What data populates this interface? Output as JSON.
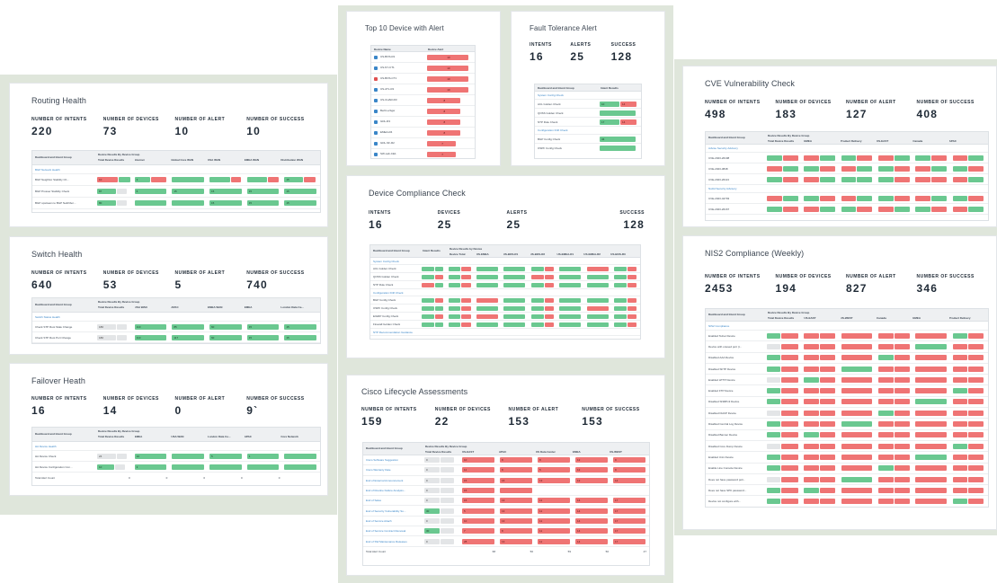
{
  "routing": {
    "title": "Routing Health",
    "stats": [
      {
        "label": "NUMBER OF INTENTS",
        "value": "220"
      },
      {
        "label": "NUMBER OF DEVICES",
        "value": "73"
      },
      {
        "label": "NUMBER OF ALERT",
        "value": "10"
      },
      {
        "label": "NUMBER OF SUCCESS",
        "value": "10"
      }
    ],
    "col_group": "Dashboard and Intent Group",
    "col_devices": "Device Results By Device Group",
    "cols": [
      "Total Device Results",
      "Internet",
      "Global Core WAN",
      "USA WAN",
      "EMEA WAN",
      "Distribution WAN"
    ],
    "group": "BGP Network Health",
    "rows": [
      {
        "name": "BGP Neighbor Stability Ch...",
        "cells": [
          [
            "r",
            "10"
          ],
          [
            "g",
            "3"
          ],
          [
            "gr",
            ""
          ],
          [
            "gr",
            ""
          ],
          [
            "gr",
            ""
          ],
          [
            "gr",
            "15"
          ]
        ]
      },
      {
        "name": "BGP Prosser Stability Check",
        "cells": [
          [
            "g",
            "87"
          ],
          [
            "g",
            "6"
          ],
          [
            "g",
            "15"
          ],
          [
            "g",
            "15"
          ],
          [
            "g",
            "15"
          ],
          [
            "g",
            "15"
          ]
        ]
      },
      {
        "name": "BGP upstream to BGP Neibhbor...",
        "cells": [
          [
            "g",
            "80"
          ],
          [
            "g",
            ""
          ],
          [
            "g",
            ""
          ],
          [
            "g",
            "15"
          ],
          [
            "g",
            "15"
          ],
          [
            "g",
            "15"
          ]
        ]
      }
    ]
  },
  "switch": {
    "title": "Switch Health",
    "stats": [
      {
        "label": "NUMBER OF INTENTS",
        "value": "640"
      },
      {
        "label": "NUMBER OF DEVICES",
        "value": "53"
      },
      {
        "label": "NUMBER OF ALERT",
        "value": "5"
      },
      {
        "label": "NUMBER OF SUCCESS",
        "value": "740"
      }
    ],
    "col_group": "Dashboard and Intent Group",
    "col_devices": "Device Results By Device Group",
    "cols": [
      "Total Device Results",
      "USA WAN",
      "APAC",
      "EMEA WAN",
      "EMEA",
      "London Data Ce..."
    ],
    "group": "Switch Status Health",
    "rows": [
      {
        "name": "Check STP Root Stale Change",
        "cells": [
          [
            "gy",
            "180"
          ],
          [
            "g",
            "110"
          ],
          [
            "g",
            "85"
          ],
          [
            "g",
            "60"
          ],
          [
            "g",
            "15"
          ],
          [
            "g",
            "15"
          ]
        ]
      },
      {
        "name": "Check STP Root Port Change",
        "cells": [
          [
            "gy",
            "180"
          ],
          [
            "g",
            "110"
          ],
          [
            "g",
            "117"
          ],
          [
            "g",
            "60"
          ],
          [
            "g",
            "15"
          ],
          [
            "g",
            "15"
          ]
        ]
      }
    ]
  },
  "failover": {
    "title": "Failover Heath",
    "stats": [
      {
        "label": "NUMBER OF INTENTS",
        "value": "16"
      },
      {
        "label": "NUMBER OF DEVICES",
        "value": "14"
      },
      {
        "label": "NUMBER OF ALERT",
        "value": "0"
      },
      {
        "label": "NUMBER OF SUCCESS",
        "value": "9`"
      }
    ],
    "col_group": "Dashboard and Intent Group",
    "col_devices": "Device Results By Device Group",
    "cols": [
      "Total Device Results",
      "EMEA",
      "USA WAN",
      "London Data Ce...",
      "APAC",
      "Core Network"
    ],
    "group": "HA Device Health",
    "rows": [
      {
        "name": "HA Device Check",
        "cells": [
          [
            "gy",
            "24"
          ],
          [
            "g",
            "10"
          ],
          [
            "g",
            ""
          ],
          [
            "g",
            "5"
          ],
          [
            "g",
            "1"
          ],
          [
            "g",
            ""
          ]
        ]
      },
      {
        "name": "HA Device Configuration Con...",
        "cells": [
          [
            "g",
            "10"
          ],
          [
            "g",
            "3"
          ],
          [
            "g",
            ""
          ],
          [
            "g",
            ""
          ],
          [
            "g",
            ""
          ],
          [
            "g",
            ""
          ]
        ]
      }
    ],
    "footer": "Total Alert Count",
    "footer_vals": [
      "0",
      "0",
      "0",
      "0",
      "0"
    ]
  },
  "top10": {
    "title": "Top 10 Device with Alert",
    "col_name": "Device Name",
    "col_alert": "Device Alert",
    "rows": [
      {
        "name": "US-BOS-R1",
        "v": "10"
      },
      {
        "name": "US-NY-CT1",
        "v": "10"
      },
      {
        "name": "US-BOS-CT1",
        "v": "10"
      },
      {
        "name": "US-ATL-R1",
        "v": "10"
      },
      {
        "name": "US-CHAR-R3",
        "v": "8"
      },
      {
        "name": "Berlin-eSgw",
        "v": "8"
      },
      {
        "name": "GDL-R3",
        "v": "8"
      },
      {
        "name": "EMEA-R4",
        "v": "8"
      },
      {
        "name": "GDL-SF-R2",
        "v": "7"
      },
      {
        "name": "SW-Lab-CE1",
        "v": "7"
      }
    ]
  },
  "fault": {
    "title": "Fault Tolerance Alert",
    "stats": [
      {
        "label": "INTENTS",
        "value": "16"
      },
      {
        "label": "ALERTS",
        "value": "25"
      },
      {
        "label": "SUCCESS",
        "value": "128"
      }
    ],
    "col_group": "Dashboard and Intent Group",
    "col_res": "Intent Results",
    "groups": [
      {
        "name": "System Config Check",
        "rows": [
          [
            "ACL Golden Check",
            "g",
            "10",
            "r",
            "14"
          ],
          [
            "QOSS Golden Check",
            "g",
            "",
            "",
            ""
          ],
          [
            "NTP Rule Check",
            "g",
            "17",
            "r",
            "14"
          ]
        ]
      },
      {
        "name": "Configuration Drift Check",
        "rows": [
          [
            "BGP Config Check",
            "g",
            "34",
            "",
            ""
          ],
          [
            "OSPF Config Check",
            "g",
            "",
            "",
            ""
          ]
        ]
      }
    ]
  },
  "compliance": {
    "title": "Device Compliance Check",
    "stats": [
      {
        "label": "INTENTS",
        "value": "16"
      },
      {
        "label": "DEVICES",
        "value": "25"
      },
      {
        "label": "ALERTS",
        "value": "25"
      },
      {
        "label": "SUCCESS",
        "value": "128"
      }
    ],
    "col_group": "Dashboard and Intent Group",
    "col_res": "Intent Results",
    "col_devices": "Device Results by Device",
    "cols": [
      "Device Total",
      "US-EMEA",
      "US-BOS-R1",
      "US-BOS-R2",
      "US-EMEA-R1",
      "US-EMEA-R2",
      "US-BOS-R3"
    ],
    "groups": [
      {
        "name": "System Config Check",
        "rows": [
          "ACL Golden Check",
          "QOSS Golden Check",
          "NTP Rule Check"
        ]
      },
      {
        "name": "Configuration Drift Check",
        "rows": [
          "BGP Config Check",
          "OSPF Config Check",
          "EIGRP Config Check",
          "Firewall Golden Check"
        ]
      },
      {
        "name": "NTP Recommendation Guidance",
        "rows": []
      }
    ]
  },
  "lifecycle": {
    "title": "Cisco Lifecycle Assessments",
    "stats": [
      {
        "label": "NUMBER OF INTENTS",
        "value": "159"
      },
      {
        "label": "NUMBER OF DEVICES",
        "value": "22"
      },
      {
        "label": "NUMBER OF ALERT",
        "value": "153"
      },
      {
        "label": "NUMBER OF SUCCESS",
        "value": "153"
      }
    ],
    "col_group": "Dashboard and Intent Group",
    "col_devices": "Device Results By Device Group",
    "cols": [
      "Total Device Results",
      "US-EAST",
      "APAC",
      "US Data Center",
      "EMEA",
      "US-WEST"
    ],
    "rows": [
      {
        "name": "Cisco Software Suggestion",
        "cells": [
          [
            "gy",
            "0"
          ],
          [
            "r",
            "10"
          ],
          [
            "r",
            "8"
          ],
          [
            "r",
            "8"
          ],
          [
            "r",
            "12"
          ],
          [
            "r",
            "9"
          ]
        ]
      },
      {
        "name": "Cisco Warranty Date",
        "cells": [
          [
            "gy",
            "0"
          ],
          [
            "r",
            "11"
          ],
          [
            "r",
            "8"
          ],
          [
            "r",
            "5"
          ],
          [
            "r",
            "12"
          ],
          [
            "r",
            "9"
          ]
        ]
      },
      {
        "name": "End of External Announcement",
        "cells": [
          [
            "gy",
            "0"
          ],
          [
            "r",
            "15"
          ],
          [
            "r",
            "16"
          ],
          [
            "r",
            "13"
          ],
          [
            "r",
            "12"
          ],
          [
            "r",
            "14"
          ]
        ]
      },
      {
        "name": "End of Routine Failure Analysis...",
        "cells": [
          [
            "gy",
            "0"
          ],
          [
            "r",
            "15"
          ],
          [
            "r",
            "",
            ""
          ],
          [
            "",
            ""
          ],
          [
            "",
            ""
          ],
          [
            "",
            ""
          ]
        ]
      },
      {
        "name": "End of Sales",
        "cells": [
          [
            "gy",
            "0"
          ],
          [
            "r",
            "15"
          ],
          [
            "r",
            "13"
          ],
          [
            "r",
            "11"
          ],
          [
            "r",
            "14"
          ],
          [
            "r",
            "17"
          ]
        ]
      },
      {
        "name": "End of Security Vulnerability Su...",
        "cells": [
          [
            "g",
            "30"
          ],
          [
            "r",
            "5"
          ],
          [
            "r",
            "13"
          ],
          [
            "r",
            "11"
          ],
          [
            "r",
            "14"
          ],
          [
            "r",
            "17"
          ]
        ]
      },
      {
        "name": "End of Service Attach",
        "cells": [
          [
            "gy",
            "0"
          ],
          [
            "r",
            "10"
          ],
          [
            "r",
            "13"
          ],
          [
            "r",
            "11"
          ],
          [
            "r",
            "14"
          ],
          [
            "r",
            "17"
          ]
        ]
      },
      {
        "name": "End of Service Contract Renewal",
        "cells": [
          [
            "g",
            "30"
          ],
          [
            "r",
            "7"
          ],
          [
            "r",
            "8"
          ],
          [
            "r",
            "11"
          ],
          [
            "r",
            "14"
          ],
          [
            "r",
            "17"
          ]
        ]
      },
      {
        "name": "End of SW Maintenance Releases",
        "cells": [
          [
            "gy",
            "0"
          ],
          [
            "r",
            "28"
          ],
          [
            "r",
            "13"
          ],
          [
            "r",
            "11"
          ],
          [
            "r",
            "14"
          ],
          [
            "r",
            "17"
          ]
        ]
      }
    ],
    "footer": "Total Alert Count",
    "footer_vals": [
      "68",
      "50",
      "59",
      "50",
      "47"
    ]
  },
  "cve": {
    "title": "CVE Vulnerability Check",
    "stats": [
      {
        "label": "NUMBER OF INTENTS",
        "value": "498"
      },
      {
        "label": "NUMBER OF DEVICES",
        "value": "183"
      },
      {
        "label": "NUMBER OF ALERT",
        "value": "127"
      },
      {
        "label": "NUMBER OF SUCCESS",
        "value": "408"
      }
    ],
    "col_group": "Dashboard and Intent Group",
    "col_devices": "Device Results By Device Group",
    "cols": [
      "Total Device Results",
      "EMEA",
      "Product Delivery",
      "US-EAST",
      "Canada",
      "APAC"
    ],
    "groups": [
      {
        "name": "Advise Security Advisory",
        "rows": [
          "CVE-2023-20198",
          "CVE-2023-3848",
          "CVE-2023-20113"
        ]
      },
      {
        "name": "Nvdid Security Advisory",
        "rows": [
          "CVE-2023-42793",
          "CVE-2023-20167"
        ]
      }
    ]
  },
  "nis2": {
    "title": "NIS2 Compliance (Weekly)",
    "stats": [
      {
        "label": "NUMBER OF INTENTS",
        "value": "2453"
      },
      {
        "label": "NUMBER OF DEVICES",
        "value": "194"
      },
      {
        "label": "NUMBER OF ALERT",
        "value": "827"
      },
      {
        "label": "NUMBER OF SUCCESS",
        "value": "346"
      }
    ],
    "col_group": "Dashboard and Intent Group",
    "col_devices": "Device Results By Device Group",
    "cols": [
      "Total Device Results",
      "US-EAST",
      "US-WEST",
      "Canada",
      "EMEA",
      "Product Delivery"
    ],
    "group": "NIS2 Compliance",
    "rows": [
      "Enabled Telnet Device",
      "Device with unused port (t...",
      "Disabled AAA Device",
      "Disabled SFTP Device",
      "Enabled HTTP Device",
      "Enabled FTP Device",
      "Disabled SNMPv3 Device",
      "Disabled DHCP Device",
      "Disabled Central Log Device",
      "Disabled Banner Device",
      "Disabled Core Dump Device",
      "Enabled Unix Device",
      "Enable Line Console Device",
      "Does not have password poli...",
      "Does not have SPK password...",
      "Device not configure with..."
    ]
  }
}
